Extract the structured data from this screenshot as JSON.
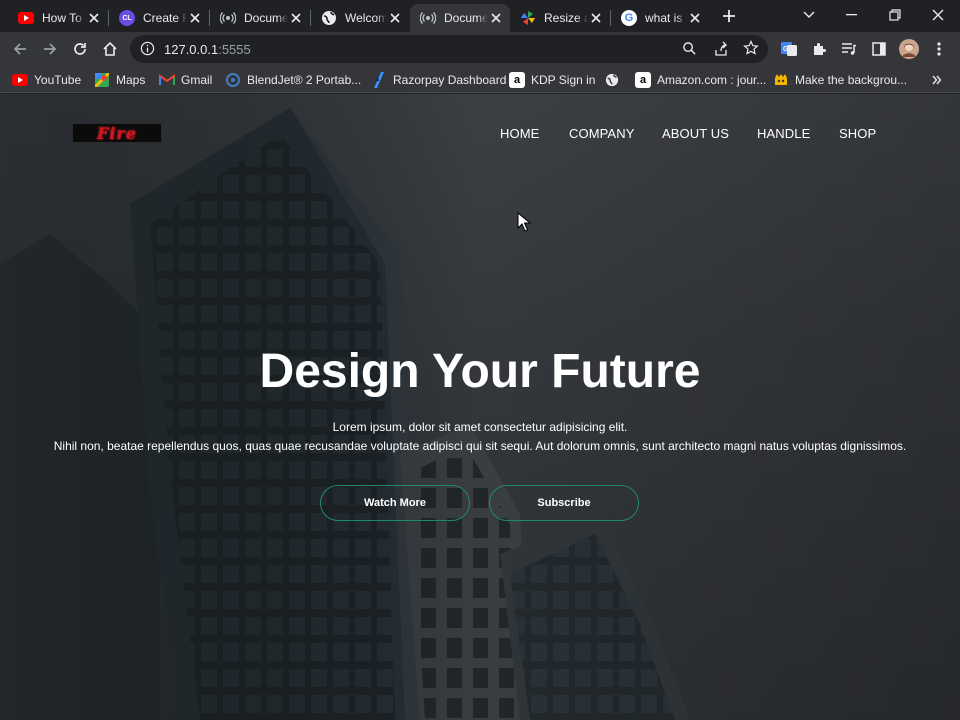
{
  "browser": {
    "tabs": [
      {
        "title": "How To",
        "favicon": "youtube-icon",
        "active": false
      },
      {
        "title": "Create F",
        "favicon": "cl-icon",
        "active": false
      },
      {
        "title": "Document",
        "favicon": "broadcast-icon",
        "active": false
      },
      {
        "title": "Welcome",
        "favicon": "globe-icon",
        "active": false
      },
      {
        "title": "Document",
        "favicon": "broadcast-icon",
        "active": true
      },
      {
        "title": "Resize a",
        "favicon": "pinwheel-icon",
        "active": false
      },
      {
        "title": "what is",
        "favicon": "google-icon",
        "active": false
      }
    ],
    "url_host": "127.0.0.1",
    "url_port": ":5555",
    "bookmarks": [
      {
        "label": "YouTube",
        "icon": "youtube-icon"
      },
      {
        "label": "Maps",
        "icon": "maps-icon"
      },
      {
        "label": "Gmail",
        "icon": "gmail-icon"
      },
      {
        "label": "BlendJet® 2 Portab...",
        "icon": "blendjet-icon"
      },
      {
        "label": "Razorpay Dashboard",
        "icon": "razorpay-icon"
      },
      {
        "label": "KDP Sign in",
        "icon": "amazon-icon"
      },
      {
        "label": "",
        "icon": "globe-icon"
      },
      {
        "label": "Amazon.com : jour...",
        "icon": "amazon-icon"
      },
      {
        "label": "Make the backgrou...",
        "icon": "remove-bg-icon"
      }
    ]
  },
  "site": {
    "logo_text": "Fire",
    "nav": [
      "HOME",
      "COMPANY",
      "ABOUT US",
      "HANDLE",
      "SHOP"
    ],
    "hero_title": "Design Your Future",
    "hero_line1": "Lorem ipsum, dolor sit amet consectetur adipisicing elit.",
    "hero_line2": "Nihil non, beatae repellendus quos, quas quae recusandae voluptate adipisci qui sit sequi. Aut dolorum omnis, sunt architecto magni natus voluptas dignissimos.",
    "buttons": [
      "Watch More",
      "Subscribe"
    ]
  },
  "colors": {
    "browser_bg": "#202124",
    "toolbar_bg": "#35363a",
    "button_border": "#1f8a6a",
    "logo_red": "#d4141f"
  }
}
